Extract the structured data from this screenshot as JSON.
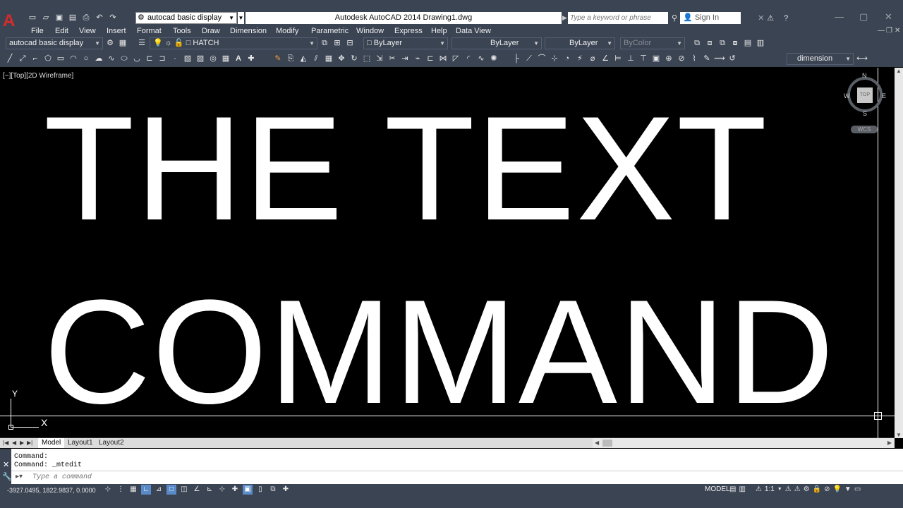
{
  "titlebar": {
    "title": "Autodesk AutoCAD 2014    Drawing1.dwg",
    "workspace": "autocad basic display",
    "search_placeholder": "Type a keyword or phrase",
    "signin": "Sign In"
  },
  "menu": [
    "File",
    "Edit",
    "View",
    "Insert",
    "Format",
    "Tools",
    "Draw",
    "Dimension",
    "Modify",
    "Parametric",
    "Window",
    "Express",
    "Help",
    "Data View"
  ],
  "toolbar1": {
    "workspace_dropdown": "autocad basic display",
    "layer_dropdown": "HATCH",
    "color_dropdown": "ByLayer",
    "linetype_dropdown": "ByLayer",
    "lineweight_dropdown": "ByLayer",
    "plotstyle_dropdown": "ByColor"
  },
  "toolbar2": {
    "dimstyle_dropdown": "dimension"
  },
  "viewport": {
    "label": "[−][Top][2D Wireframe]",
    "text_line1": "THE TEXT",
    "text_line2": "COMMAND",
    "viewcube_face": "TOP",
    "compass_n": "N",
    "compass_s": "S",
    "compass_e": "E",
    "compass_w": "W",
    "wcs_label": "WCS",
    "ucs_x": "X",
    "ucs_y": "Y"
  },
  "tabs": [
    {
      "label": "Model",
      "active": true
    },
    {
      "label": "Layout1",
      "active": false
    },
    {
      "label": "Layout2",
      "active": false
    }
  ],
  "command": {
    "history_line1": "Command:",
    "history_line2": "Command: _mtedit",
    "input_placeholder": "Type a command"
  },
  "status": {
    "coordinates": "-3927.0495, 1822.9837, 0.0000",
    "model_label": "MODEL",
    "annotation_scale": "1:1"
  },
  "colors": {
    "chrome": "#3b4453",
    "canvas": "#000000",
    "accent": "#5a8ac8",
    "app_logo": "#d42b2b"
  }
}
